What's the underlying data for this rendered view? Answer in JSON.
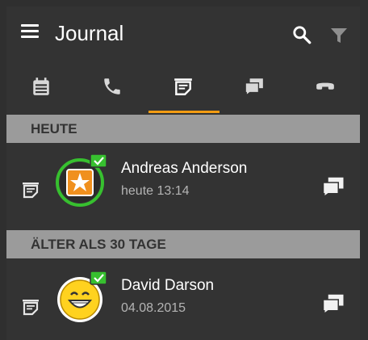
{
  "app": {
    "title": "Journal"
  },
  "colors": {
    "accent": "#f39c12",
    "background": "#333333",
    "section": "#9b9b9b",
    "presence": "#37c02f"
  },
  "tabs": [
    {
      "icon": "calendar-icon",
      "active": false
    },
    {
      "icon": "phone-icon",
      "active": false
    },
    {
      "icon": "note-icon",
      "active": true
    },
    {
      "icon": "chat-icon",
      "active": false
    },
    {
      "icon": "voicemail-icon",
      "active": false
    }
  ],
  "sections": [
    {
      "title": "HEUTE",
      "entries": [
        {
          "name": "Andreas Anderson",
          "time": "heute 13:14"
        }
      ]
    },
    {
      "title": "ÄLTER ALS 30 TAGE",
      "entries": [
        {
          "name": "David Darson",
          "time": "04.08.2015"
        }
      ]
    }
  ]
}
